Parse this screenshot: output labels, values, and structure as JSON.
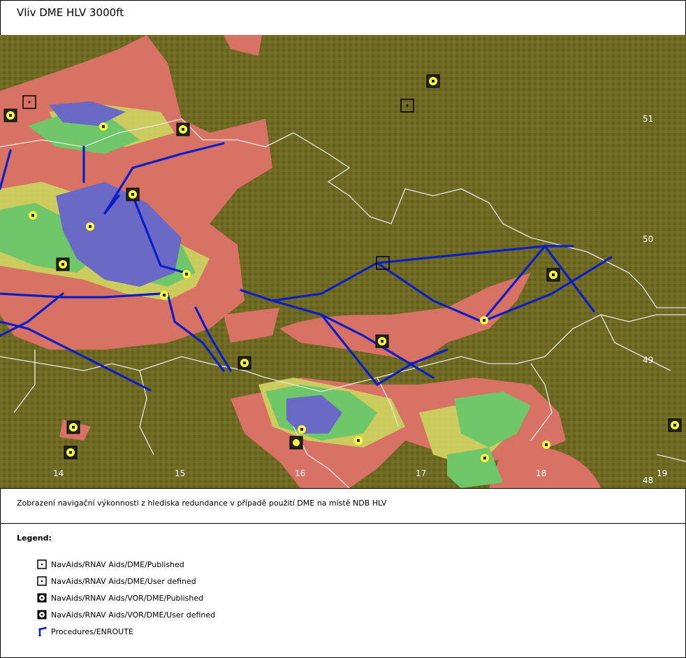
{
  "header": {
    "title": "Vliv DME HLV 3000ft"
  },
  "map": {
    "longitude_labels": [
      "14",
      "15",
      "16",
      "17",
      "18",
      "19"
    ],
    "latitude_labels": [
      "51",
      "50",
      "49",
      "48"
    ],
    "colors": {
      "terrain": "#6f6a22",
      "coverage_red": "#e0736a",
      "coverage_yellow": "#d4d464",
      "coverage_green": "#6fcf6f",
      "coverage_blue": "#6a6ad4",
      "route": "#0a1ec8",
      "border": "#e8e8e8",
      "navaid_yellow": "#ffff40"
    }
  },
  "caption": {
    "text": "Zobrazení navigační výkonnosti z hlediska redundance v případě použití DME na místě NDB HLV"
  },
  "legend": {
    "title": "Legend:",
    "items": [
      {
        "label": "NavAids/RNAV Aids/DME/Published",
        "icon": "dme-published-icon"
      },
      {
        "label": "NavAids/RNAV Aids/DME/User defined",
        "icon": "dme-user-defined-icon"
      },
      {
        "label": "NavAids/RNAV Aids/VOR/DME/Published",
        "icon": "vor-dme-published-icon"
      },
      {
        "label": "NavAids/RNAV Aids/VOR/DME/User defined",
        "icon": "vor-dme-user-defined-icon"
      },
      {
        "label": "Procedures/ENROUTE",
        "icon": "enroute-procedure-icon"
      }
    ]
  }
}
